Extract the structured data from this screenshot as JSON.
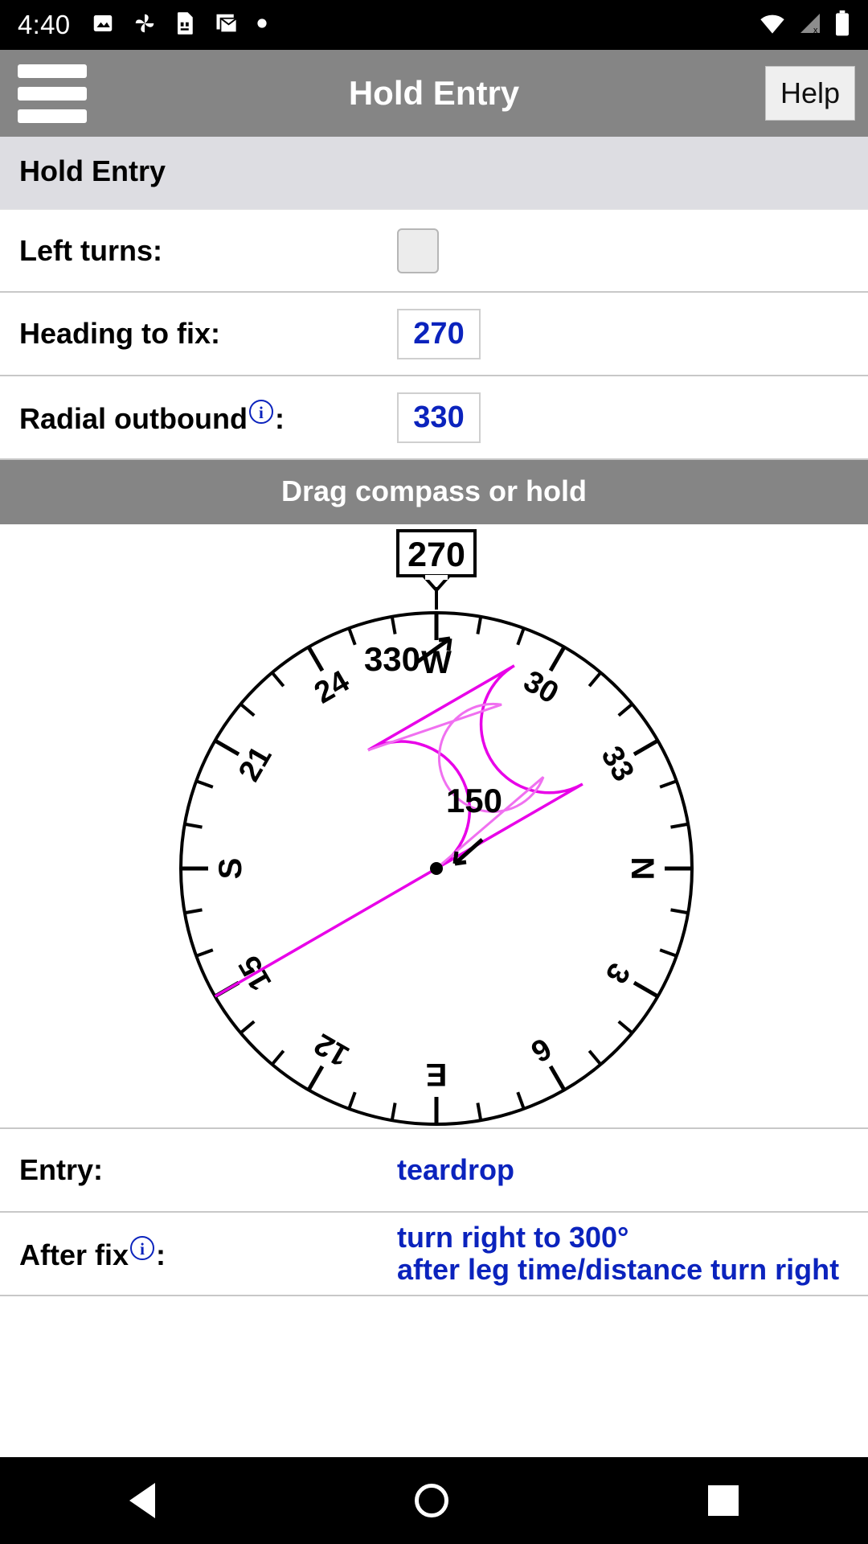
{
  "statusbar": {
    "time": "4:40",
    "left_icons": [
      "image-icon",
      "pinwheel-icon",
      "sim-card-icon",
      "gmail-icon",
      "dot-icon"
    ],
    "right_icons": [
      "wifi-icon",
      "cellular-signal-off-icon",
      "battery-icon"
    ]
  },
  "appbar": {
    "menu_icon": "hamburger-menu-icon",
    "title": "Hold Entry",
    "help_label": "Help"
  },
  "section": {
    "title": "Hold Entry"
  },
  "form": {
    "left_turns": {
      "label": "Left turns:",
      "checked": false
    },
    "heading_to_fix": {
      "label": "Heading to fix:",
      "value": "270"
    },
    "radial_outbound": {
      "label": "Radial outbound",
      "info_icon": "info-circle-icon",
      "suffix": ":",
      "value": "330"
    }
  },
  "dragbar": {
    "label": "Drag compass or hold"
  },
  "compass": {
    "index_value": "270",
    "outbound_label": "330",
    "inbound_label": "150",
    "center_fix": "fix-point",
    "cardinals": [
      {
        "label": "W",
        "bearing": 270
      },
      {
        "label": "N",
        "bearing": 0
      },
      {
        "label": "E",
        "bearing": 90
      },
      {
        "label": "S",
        "bearing": 180
      }
    ],
    "numbered_ticks": [
      {
        "label": "3",
        "bearing": 30
      },
      {
        "label": "6",
        "bearing": 60
      },
      {
        "label": "12",
        "bearing": 120
      },
      {
        "label": "15",
        "bearing": 150
      },
      {
        "label": "21",
        "bearing": 210
      },
      {
        "label": "24",
        "bearing": 240
      },
      {
        "label": "30",
        "bearing": 300
      },
      {
        "label": "33",
        "bearing": 330
      }
    ],
    "hold_color": "#e800e8",
    "entry_path_color": "#f070f0"
  },
  "results": {
    "entry": {
      "label": "Entry:",
      "value": "teardrop"
    },
    "after_fix": {
      "label": "After fix",
      "info_icon": "info-circle-icon",
      "suffix": ":",
      "value": "turn right to 300°\nafter leg time/distance turn right"
    }
  },
  "navbar": {
    "back": "back-triangle-icon",
    "home": "home-circle-icon",
    "recents": "recents-square-icon"
  }
}
